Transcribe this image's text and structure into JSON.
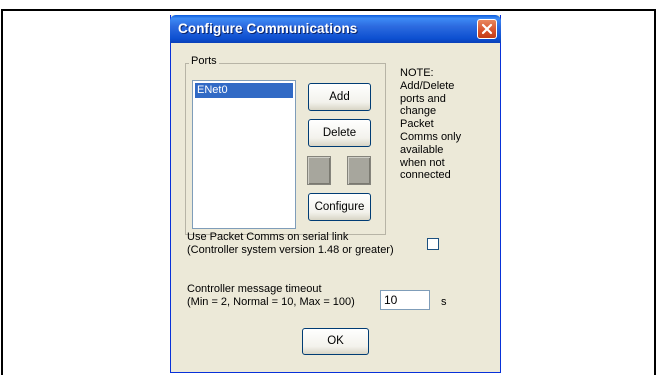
{
  "dialog": {
    "title": "Configure Communications",
    "close_icon": "close-x-icon",
    "ports_group_label": "Ports",
    "ports": [
      "ENet0"
    ],
    "buttons": {
      "add": "Add",
      "delete": "Delete",
      "configure": "Configure",
      "ok": "OK"
    },
    "note_lines": [
      "NOTE:",
      "Add/Delete",
      "ports and",
      "change",
      "Packet",
      "Comms only",
      "available",
      "when not",
      "connected"
    ],
    "packet_comms": {
      "line1": "Use Packet Comms on serial link",
      "line2": "(Controller system version 1.48 or greater)",
      "checked": false
    },
    "timeout": {
      "line1": "Controller message timeout",
      "line2": "(Min = 2, Normal = 10, Max = 100)",
      "value": "10",
      "unit": "s"
    }
  },
  "colors": {
    "titlebar": "#0a5bdc",
    "dialog_bg": "#ece9d8",
    "selection": "#316ac5",
    "close_button": "#d7512b"
  }
}
